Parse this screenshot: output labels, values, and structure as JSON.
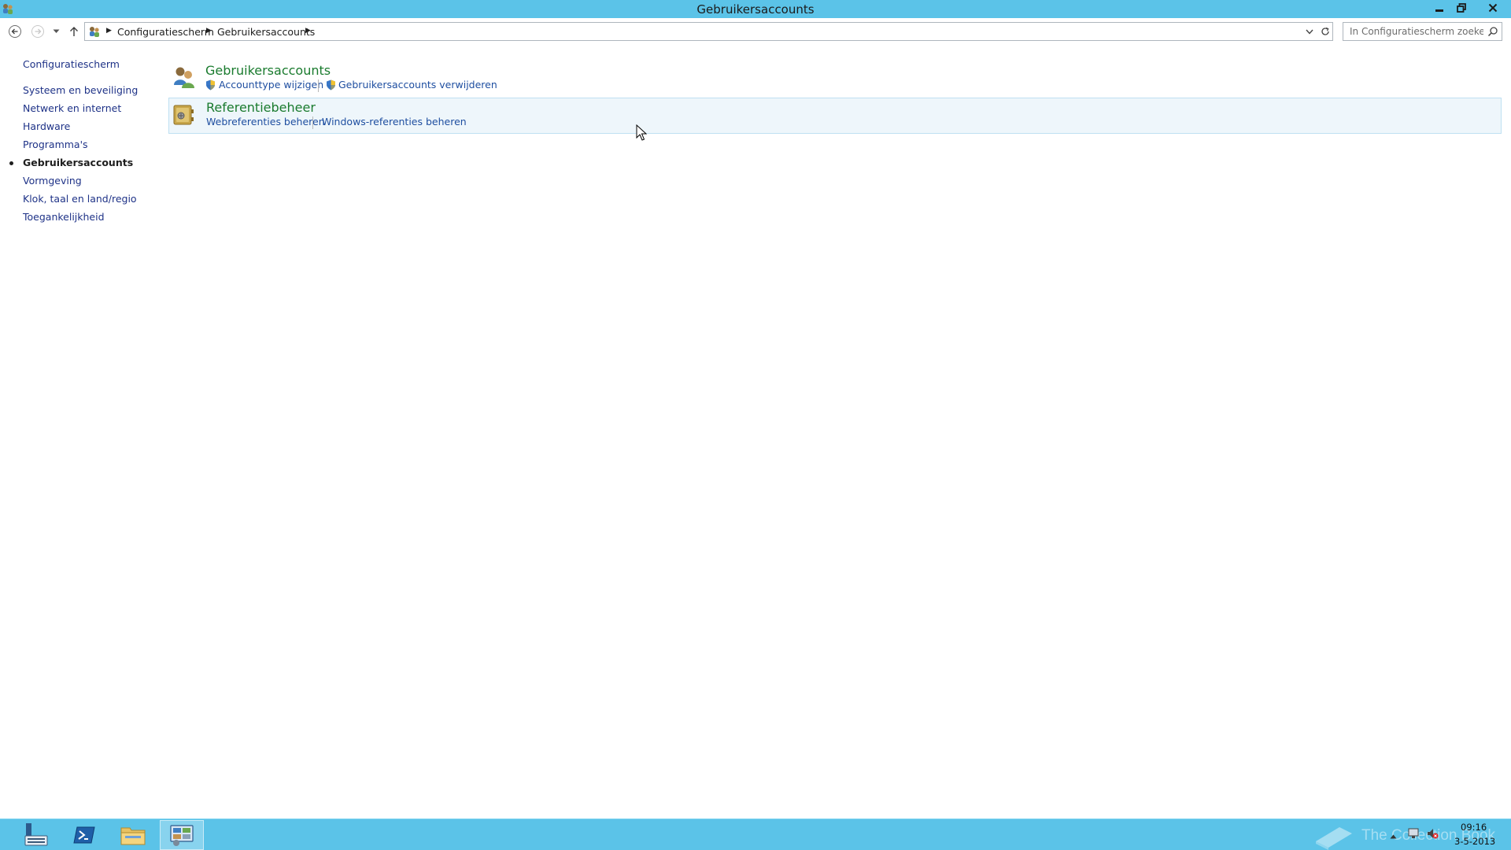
{
  "window": {
    "title": "Gebruikersaccounts"
  },
  "address": {
    "crumbs": [
      "Configuratiescherm",
      "Gebruikersaccounts"
    ]
  },
  "search": {
    "placeholder": "In Configuratiescherm zoeken"
  },
  "sidebar": {
    "home": "Configuratiescherm",
    "items": [
      {
        "label": "Systeem en beveiliging",
        "active": false
      },
      {
        "label": "Netwerk en internet",
        "active": false
      },
      {
        "label": "Hardware",
        "active": false
      },
      {
        "label": "Programma's",
        "active": false
      },
      {
        "label": "Gebruikersaccounts",
        "active": true
      },
      {
        "label": "Vormgeving",
        "active": false
      },
      {
        "label": "Klok, taal en land/regio",
        "active": false
      },
      {
        "label": "Toegankelijkheid",
        "active": false
      }
    ]
  },
  "main": {
    "categories": [
      {
        "title": "Gebruikersaccounts",
        "icon": "users-icon",
        "links": [
          {
            "label": "Accounttype wijzigen",
            "shield": true
          },
          {
            "label": "Gebruikersaccounts verwijderen",
            "shield": true
          }
        ]
      },
      {
        "title": "Referentiebeheer",
        "icon": "credential-vault-icon",
        "links": [
          {
            "label": "Webreferenties beheren",
            "shield": false
          },
          {
            "label": "Windows-referenties beheren",
            "shield": false
          }
        ]
      }
    ]
  },
  "taskbar": {
    "buttons": [
      "server-manager-icon",
      "powershell-icon",
      "file-explorer-icon",
      "control-panel-icon"
    ],
    "active_button": "control-panel-icon",
    "watermark": "The Collection Book",
    "clock": {
      "time": "09:16",
      "date": "3-5-2013"
    }
  },
  "colors": {
    "titlebar": "#5bc3e8",
    "category_title": "#1a7b2e",
    "link": "#1e4ea0",
    "nav_link": "#1e3287"
  }
}
